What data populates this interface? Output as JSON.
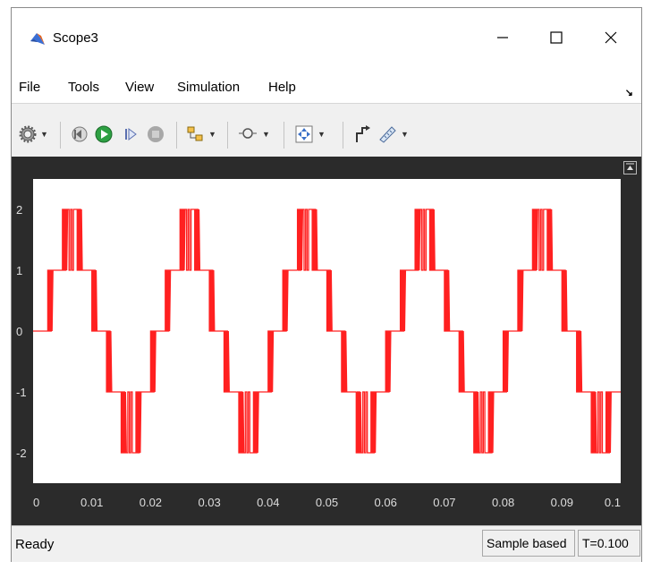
{
  "window": {
    "title": "Scope3",
    "icon": "matlab-icon"
  },
  "window_controls": {
    "minimize": "—",
    "maximize": "☐",
    "close": "X"
  },
  "menu": {
    "items": [
      "File",
      "Tools",
      "View",
      "Simulation",
      "Help"
    ]
  },
  "toolbar": {
    "icons": [
      "gear-icon",
      "step-back-icon",
      "run-icon",
      "step-forward-icon",
      "stop-icon",
      "signal-select-icon",
      "zoom-icon",
      "fit-axes-icon",
      "highlight-block-icon",
      "measurements-icon"
    ]
  },
  "colors": {
    "trace": "#ff2020",
    "plot_bg": "#ffffff",
    "panel_bg": "#2b2b2b",
    "axis_text": "#dddddd"
  },
  "chart_data": {
    "type": "line",
    "xlim": [
      0,
      0.1
    ],
    "ylim": [
      -2.5,
      2.5
    ],
    "xticks": [
      0,
      0.01,
      0.02,
      0.03,
      0.04,
      0.05,
      0.06,
      0.07,
      0.08,
      0.09,
      0.1
    ],
    "xtick_labels": [
      "0",
      "0.01",
      "0.02",
      "0.03",
      "0.04",
      "0.05",
      "0.06",
      "0.07",
      "0.08",
      "0.09",
      "0.1"
    ],
    "yticks": [
      2,
      1,
      0,
      -1,
      -2
    ],
    "ytick_labels": [
      "2",
      "1",
      "0",
      "-1",
      "-2"
    ],
    "grid": false,
    "period": 0.02,
    "levels": [
      0,
      1,
      2,
      1,
      0,
      -1,
      -2,
      -1
    ],
    "series": [
      {
        "values_description_free": true
      }
    ]
  },
  "status": {
    "text": "Ready",
    "mode": "Sample based",
    "time": "T=0.100"
  }
}
